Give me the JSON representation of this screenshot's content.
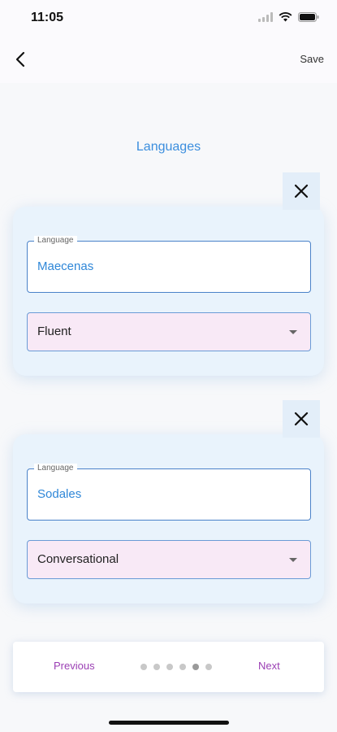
{
  "status": {
    "time": "11:05"
  },
  "app_bar": {
    "save_label": "Save"
  },
  "section": {
    "title": "Languages"
  },
  "languages": [
    {
      "field_label": "Language",
      "value": "Maecenas",
      "proficiency": "Fluent"
    },
    {
      "field_label": "Language",
      "value": "Sodales",
      "proficiency": "Conversational"
    }
  ],
  "pager": {
    "previous_label": "Previous",
    "next_label": "Next",
    "total_pages": 6,
    "current_page": 5
  },
  "colors": {
    "accent": "#3b8ede",
    "nav_text": "#9b3fb4",
    "dropdown_bg": "#f8e9f6",
    "card_bg": "#e9f3fc"
  }
}
